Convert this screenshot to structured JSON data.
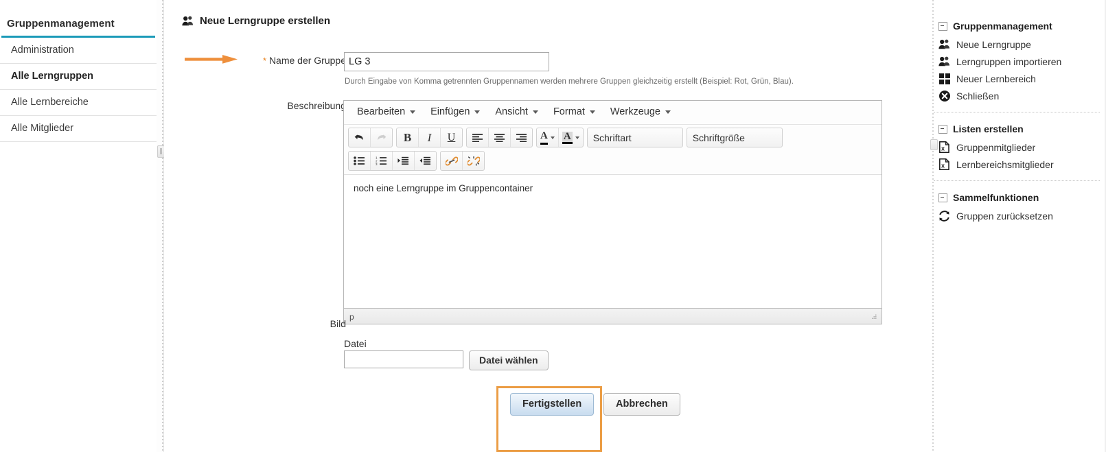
{
  "left_sidebar": {
    "title": "Gruppenmanagement",
    "accent_color": "#1b9ab8",
    "items": [
      {
        "label": "Administration",
        "active": false
      },
      {
        "label": "Alle Lerngruppen",
        "active": true
      },
      {
        "label": "Alle Lernbereiche",
        "active": false
      },
      {
        "label": "Alle Mitglieder",
        "active": false
      }
    ]
  },
  "main": {
    "heading": "Neue Lerngruppe erstellen",
    "heading_icon": "users-icon",
    "annotation_arrow_color": "#ee8f3c",
    "name_field": {
      "required_marker": "*",
      "label": "Name der Gruppe",
      "value": "LG 3",
      "placeholder": "",
      "hint": "Durch Eingabe von Komma getrennten Gruppennamen werden mehrere Gruppen gleichzeitig erstellt (Beispiel: Rot, Grün, Blau)."
    },
    "description": {
      "label": "Beschreibung",
      "menubar": [
        {
          "label": "Bearbeiten",
          "icon": "chevron-down-icon"
        },
        {
          "label": "Einfügen",
          "icon": "chevron-down-icon"
        },
        {
          "label": "Ansicht",
          "icon": "chevron-down-icon"
        },
        {
          "label": "Format",
          "icon": "chevron-down-icon"
        },
        {
          "label": "Werkzeuge",
          "icon": "chevron-down-icon"
        }
      ],
      "toolbar_row1": [
        {
          "name": "undo-icon",
          "glyph": "↶",
          "title": "Rückgängig",
          "disabled": false
        },
        {
          "name": "redo-icon",
          "glyph": "↷",
          "title": "Wiederherstellen",
          "disabled": true
        },
        {
          "name": "bold-icon",
          "glyph": "B",
          "title": "Fett",
          "disabled": false
        },
        {
          "name": "italic-icon",
          "glyph": "I",
          "title": "Kursiv",
          "disabled": false
        },
        {
          "name": "underline-icon",
          "glyph": "U",
          "title": "Unterstrichen",
          "disabled": false
        },
        {
          "name": "align-left-icon",
          "glyph": "",
          "title": "Linksbündig",
          "disabled": false
        },
        {
          "name": "align-center-icon",
          "glyph": "",
          "title": "Zentriert",
          "disabled": false
        },
        {
          "name": "align-right-icon",
          "glyph": "",
          "title": "Rechtsbündig",
          "disabled": false
        },
        {
          "name": "text-color-icon",
          "glyph": "A",
          "title": "Textfarbe",
          "disabled": false
        },
        {
          "name": "background-color-icon",
          "glyph": "A",
          "title": "Hintergrundfarbe",
          "disabled": false
        }
      ],
      "font_select": "Schriftart",
      "fontsize_select": "Schriftgröße",
      "toolbar_row2": [
        {
          "name": "bullet-list-icon",
          "title": "Aufzählung"
        },
        {
          "name": "numbered-list-icon",
          "title": "Nummerierte Liste"
        },
        {
          "name": "indent-icon",
          "title": "Einzug vergrößern"
        },
        {
          "name": "outdent-icon",
          "title": "Einzug verkleinern"
        },
        {
          "name": "link-icon",
          "title": "Link einfügen"
        },
        {
          "name": "unlink-icon",
          "title": "Link entfernen"
        }
      ],
      "content": "noch eine Lerngruppe im Gruppencontainer",
      "statusbar_path": "p",
      "resize_handle_icon": "resize-grip-icon"
    },
    "image_field": {
      "label": "Bild",
      "file_label": "Datei",
      "file_value": "",
      "browse_button": "Datei wählen"
    },
    "actions": {
      "submit": "Fertigstellen",
      "cancel": "Abbrechen",
      "highlight_color": "#eb9d45"
    }
  },
  "right_sidebar": {
    "sections": [
      {
        "title": "Gruppenmanagement",
        "collapse_icon": "minus-box-icon",
        "items": [
          {
            "label": "Neue Lerngruppe",
            "icon": "users-icon"
          },
          {
            "label": "Lerngruppen importieren",
            "icon": "users-icon"
          },
          {
            "label": "Neuer Lernbereich",
            "icon": "grid-icon"
          },
          {
            "label": "Schließen",
            "icon": "close-circle-icon"
          }
        ]
      },
      {
        "title": "Listen erstellen",
        "collapse_icon": "minus-box-icon",
        "items": [
          {
            "label": "Gruppenmitglieder",
            "icon": "excel-file-icon"
          },
          {
            "label": "Lernbereichsmitglieder",
            "icon": "excel-file-icon"
          }
        ]
      },
      {
        "title": "Sammelfunktionen",
        "collapse_icon": "minus-box-icon",
        "items": [
          {
            "label": "Gruppen zurücksetzen",
            "icon": "refresh-icon"
          }
        ]
      }
    ]
  }
}
